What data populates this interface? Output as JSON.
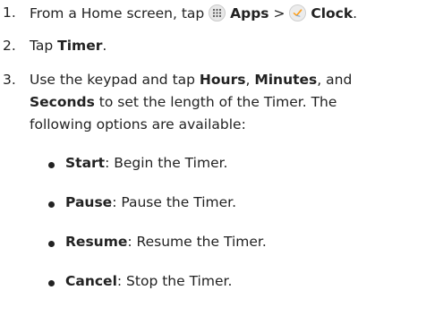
{
  "steps": [
    {
      "number": "1.",
      "text_a": "From a Home screen, tap ",
      "apps_label": "Apps",
      "separator": " > ",
      "clock_label": "Clock",
      "end": "."
    },
    {
      "number": "2.",
      "text_a": "Tap ",
      "timer_label": "Timer",
      "end": "."
    },
    {
      "number": "3.",
      "text_a": "Use the keypad and tap ",
      "hours_label": "Hours",
      "comma1": ", ",
      "minutes_label": "Minutes",
      "text_b": ", and",
      "seconds_label": "Seconds",
      "text_c": " to set the length of the Timer. The",
      "text_d": "following options are available:"
    }
  ],
  "options": [
    {
      "label": "Start",
      "description": ": Begin the Timer."
    },
    {
      "label": "Pause",
      "description": ": Pause the Timer."
    },
    {
      "label": "Resume",
      "description": ": Resume the Timer."
    },
    {
      "label": "Cancel",
      "description": ": Stop the Timer."
    }
  ],
  "icons": {
    "apps": "apps-grid-icon",
    "clock": "clock-app-icon"
  },
  "colors": {
    "text": "#222222",
    "icon_background": "#e8e8e8"
  }
}
